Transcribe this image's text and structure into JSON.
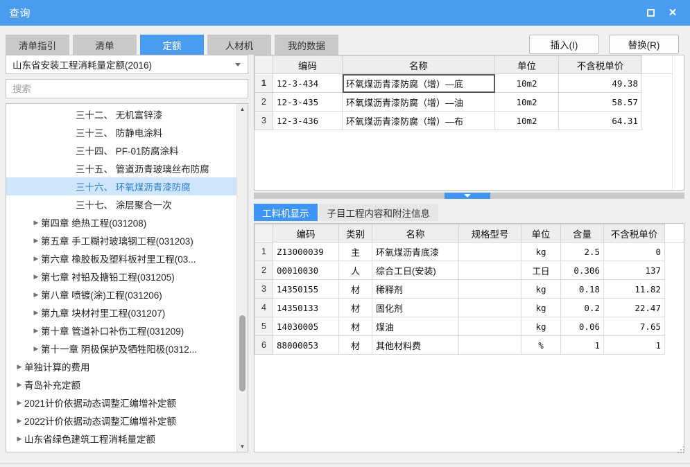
{
  "window": {
    "title": "查询",
    "maximize_label": "maximize",
    "close_label": "×"
  },
  "tabs": [
    {
      "label": "清单指引",
      "active": false
    },
    {
      "label": "清单",
      "active": false
    },
    {
      "label": "定额",
      "active": true
    },
    {
      "label": "人材机",
      "active": false
    },
    {
      "label": "我的数据",
      "active": false
    }
  ],
  "toolbar": {
    "insert_label": "插入(I)",
    "replace_label": "替换(R)"
  },
  "left": {
    "library_select": "山东省安装工程消耗量定额(2016)",
    "search_placeholder": "搜索",
    "search_value": "",
    "tree": [
      {
        "label": "三十二、 无机富锌漆",
        "depth": 3,
        "arrow": false,
        "selected": false
      },
      {
        "label": "三十三、 防静电涂料",
        "depth": 3,
        "arrow": false,
        "selected": false
      },
      {
        "label": "三十四、 PF-01防腐涂料",
        "depth": 3,
        "arrow": false,
        "selected": false
      },
      {
        "label": "三十五、 管道沥青玻璃丝布防腐",
        "depth": 3,
        "arrow": false,
        "selected": false
      },
      {
        "label": "三十六、 环氧煤沥青漆防腐",
        "depth": 3,
        "arrow": false,
        "selected": true
      },
      {
        "label": "三十七、 涂层聚合一次",
        "depth": 3,
        "arrow": false,
        "selected": false
      },
      {
        "label": "第四章 绝热工程(031208)",
        "depth": 2,
        "arrow": true,
        "selected": false
      },
      {
        "label": "第五章 手工糊衬玻璃钢工程(031203)",
        "depth": 2,
        "arrow": true,
        "selected": false
      },
      {
        "label": "第六章 橡胶板及塑料板衬里工程(03...",
        "depth": 2,
        "arrow": true,
        "selected": false
      },
      {
        "label": "第七章 衬铅及搪铅工程(031205)",
        "depth": 2,
        "arrow": true,
        "selected": false
      },
      {
        "label": "第八章 喷镀(涂)工程(031206)",
        "depth": 2,
        "arrow": true,
        "selected": false
      },
      {
        "label": "第九章 块材衬里工程(031207)",
        "depth": 2,
        "arrow": true,
        "selected": false
      },
      {
        "label": "第十章 管道补口补伤工程(031209)",
        "depth": 2,
        "arrow": true,
        "selected": false
      },
      {
        "label": "第十一章 阴极保护及牺牲阳极(0312...",
        "depth": 2,
        "arrow": true,
        "selected": false
      },
      {
        "label": "单独计算的费用",
        "depth": 1,
        "arrow": true,
        "selected": false
      },
      {
        "label": "青岛补充定额",
        "depth": 1,
        "arrow": true,
        "selected": false
      },
      {
        "label": "2021计价依据动态调整汇编增补定额",
        "depth": 1,
        "arrow": true,
        "selected": false
      },
      {
        "label": "2022计价依据动态调整汇编增补定额",
        "depth": 1,
        "arrow": true,
        "selected": false
      },
      {
        "label": "山东省绿色建筑工程消耗量定额",
        "depth": 1,
        "arrow": true,
        "selected": false
      }
    ]
  },
  "quota_table": {
    "columns": [
      "",
      "编码",
      "名称",
      "单位",
      "不含税单价"
    ],
    "rows": [
      {
        "no": "1",
        "code": "12-3-434",
        "name": "环氧煤沥青漆防腐（增）—底",
        "unit": "10m2",
        "price": "49.38",
        "selected": true
      },
      {
        "no": "2",
        "code": "12-3-435",
        "name": "环氧煤沥青漆防腐（增）—油",
        "unit": "10m2",
        "price": "58.57",
        "selected": false
      },
      {
        "no": "3",
        "code": "12-3-436",
        "name": "环氧煤沥青漆防腐（增）—布",
        "unit": "10m2",
        "price": "64.31",
        "selected": false
      }
    ]
  },
  "bottom_tabs": [
    {
      "label": "工料机显示",
      "active": true
    },
    {
      "label": "子目工程内容和附注信息",
      "active": false
    }
  ],
  "detail_table": {
    "columns": [
      "",
      "编码",
      "类别",
      "名称",
      "规格型号",
      "单位",
      "含量",
      "不含税单价"
    ],
    "rows": [
      {
        "no": "1",
        "code": "Z13000039",
        "category": "主",
        "name": "环氧煤沥青底漆",
        "spec": "",
        "unit": "kg",
        "qty": "2.5",
        "price": "0"
      },
      {
        "no": "2",
        "code": "00010030",
        "category": "人",
        "name": "综合工日(安装)",
        "spec": "",
        "unit": "工日",
        "qty": "0.306",
        "price": "137"
      },
      {
        "no": "3",
        "code": "14350155",
        "category": "材",
        "name": "稀释剂",
        "spec": "",
        "unit": "kg",
        "qty": "0.18",
        "price": "11.82"
      },
      {
        "no": "4",
        "code": "14350133",
        "category": "材",
        "name": "固化剂",
        "spec": "",
        "unit": "kg",
        "qty": "0.2",
        "price": "22.47"
      },
      {
        "no": "5",
        "code": "14030005",
        "category": "材",
        "name": "煤油",
        "spec": "",
        "unit": "kg",
        "qty": "0.06",
        "price": "7.65"
      },
      {
        "no": "6",
        "code": "88000053",
        "category": "材",
        "name": "其他材料费",
        "spec": "",
        "unit": "%",
        "qty": "1",
        "price": "1"
      }
    ]
  },
  "colors": {
    "accent": "#4a9cf0",
    "header_highlight": "#fbe0c2",
    "tree_selection": "#cfe5fa",
    "splitter": "#3d96f7"
  }
}
